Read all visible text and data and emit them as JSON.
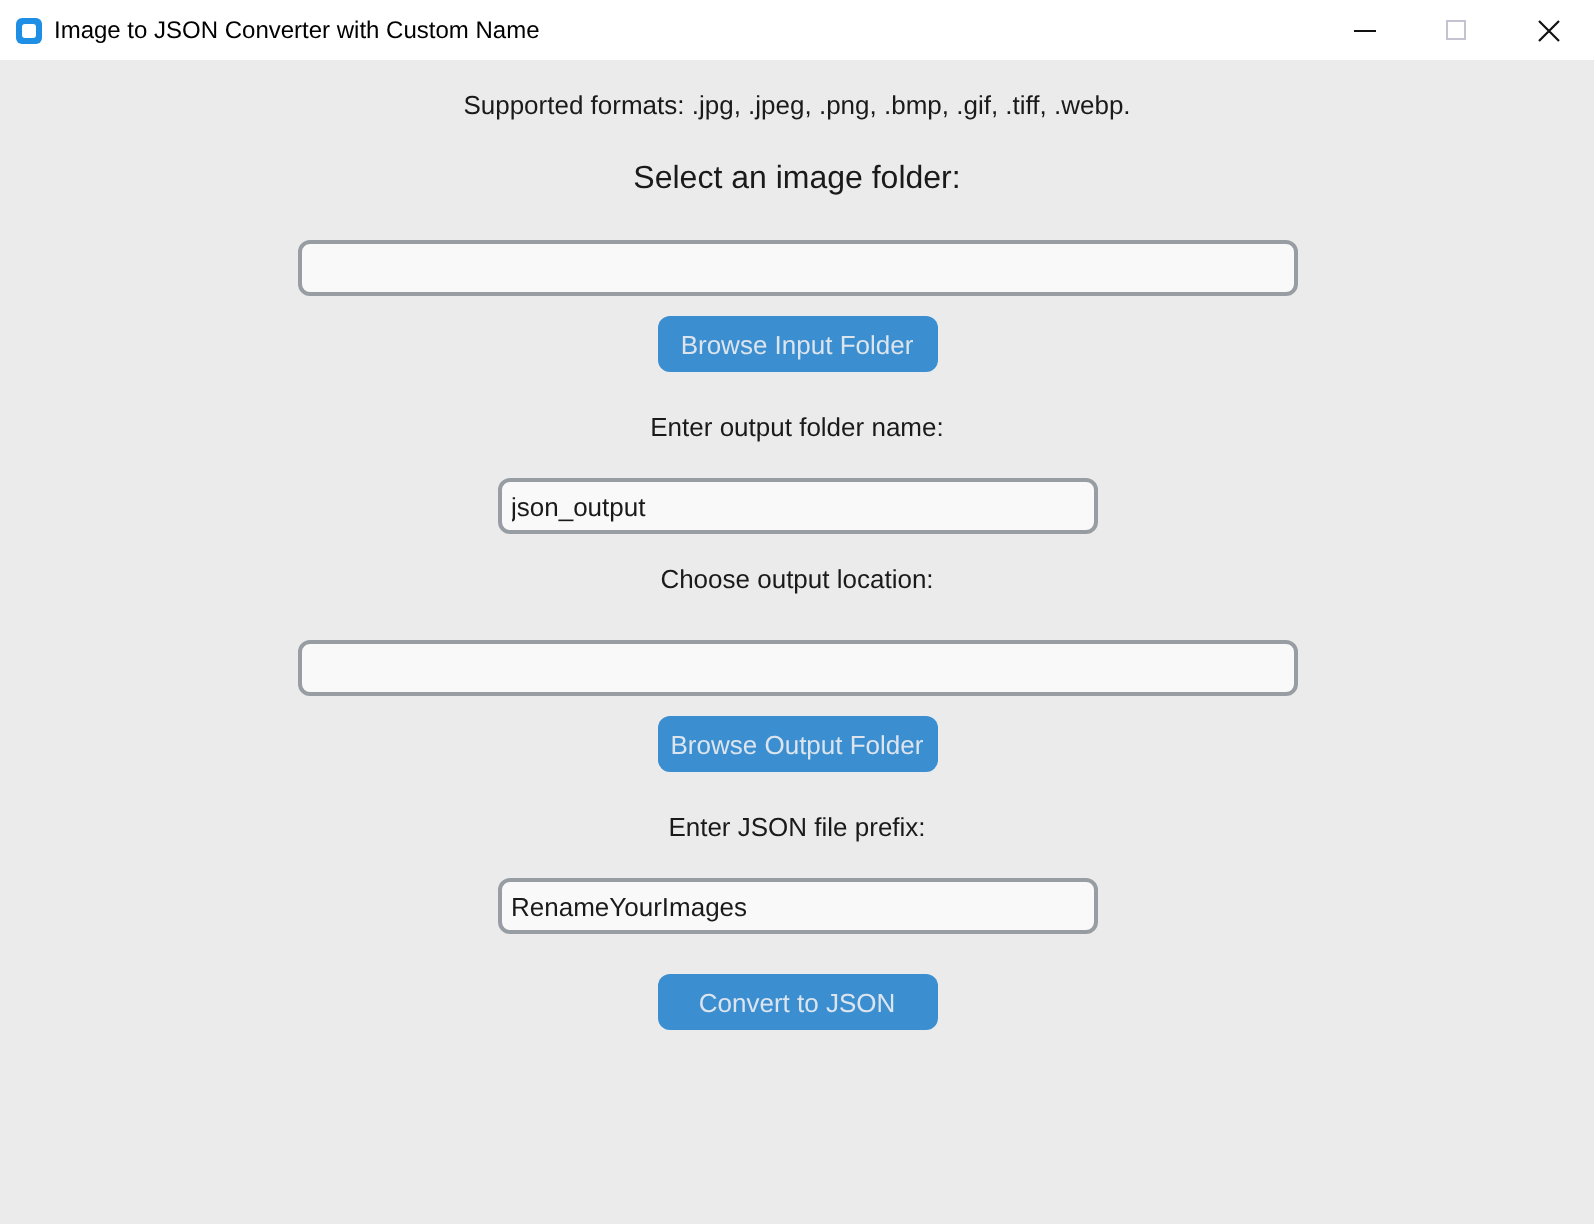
{
  "window": {
    "title": "Image to JSON Converter with Custom Name",
    "controls": [
      {
        "kind": "minimize",
        "disabled": false
      },
      {
        "kind": "maximize",
        "disabled": true
      },
      {
        "kind": "close",
        "disabled": false
      }
    ]
  },
  "form": {
    "items": [
      {
        "kind": "note",
        "text": "Supported formats: .jpg, .jpeg, .png, .bmp, .gif, .tiff, .webp."
      },
      {
        "kind": "heading",
        "text": "Select an image folder:"
      },
      {
        "kind": "pathfield"
      },
      {
        "kind": "button",
        "label": "Browse Input Folder"
      },
      {
        "kind": "label",
        "text": "Enter output folder name:"
      },
      {
        "kind": "textfield",
        "value": "json_output"
      },
      {
        "kind": "label",
        "text": "Choose output location:"
      },
      {
        "kind": "pathfield"
      },
      {
        "kind": "button",
        "label": "Browse Output Folder"
      },
      {
        "kind": "label",
        "text": "Enter JSON file prefix:"
      },
      {
        "kind": "textfield",
        "value": "RenameYourImages"
      },
      {
        "kind": "button",
        "label": "Convert to JSON"
      }
    ]
  }
}
